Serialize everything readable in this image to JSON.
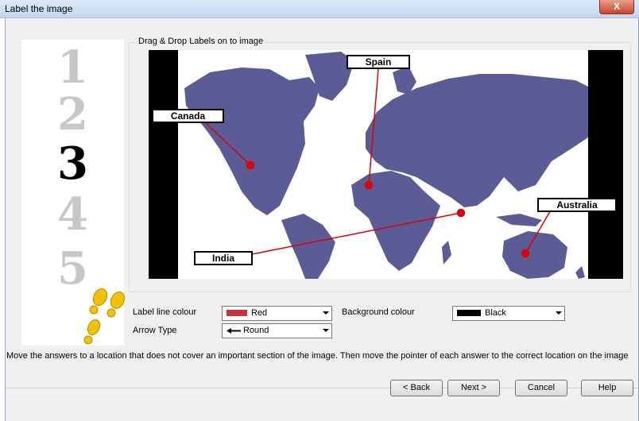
{
  "window": {
    "title": "Label the image",
    "close_label": "X"
  },
  "steps": {
    "items": [
      "1",
      "2",
      "3",
      "4",
      "5"
    ],
    "active": "3"
  },
  "image_group": {
    "label": "Drag & Drop Labels on to image",
    "labels": [
      "Spain",
      "Canada",
      "Australia",
      "India"
    ]
  },
  "options": {
    "line_colour_label": "Label line colour",
    "line_colour_value": "Red",
    "line_colour_swatch": "#c8323c",
    "arrow_type_label": "Arrow Type",
    "arrow_type_value": "Round",
    "background_colour_label": "Background colour",
    "background_colour_value": "Black",
    "background_colour_swatch": "#000000"
  },
  "instructions": "Move the answers to a location that does not cover an important section of the image. Then move the pointer of each answer to the correct location on the image",
  "buttons": {
    "back": "< Back",
    "next": "Next >",
    "cancel": "Cancel",
    "help": "Help"
  },
  "colors": {
    "map_land": "#5b5b96",
    "pointer_line": "#e00000",
    "title_bar": "#cfe0f4"
  }
}
